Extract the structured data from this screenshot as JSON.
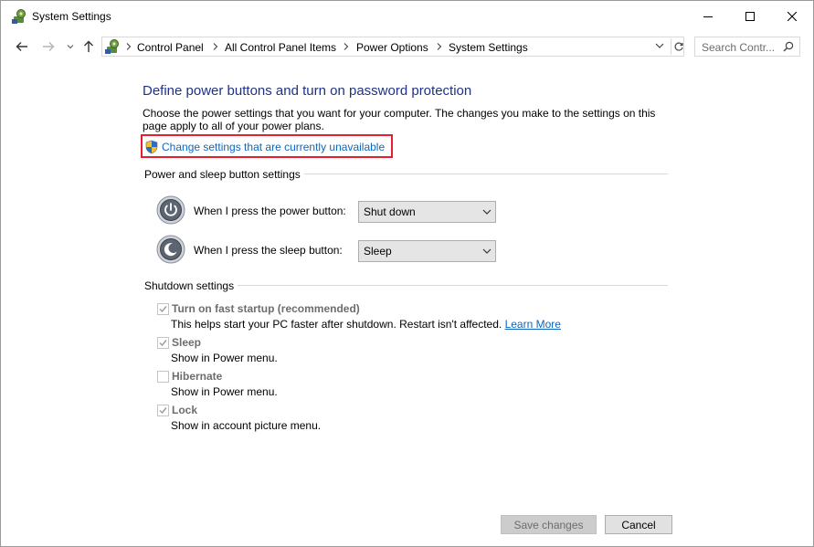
{
  "window": {
    "title": "System Settings"
  },
  "nav": {
    "breadcrumbs": [
      "Control Panel",
      "All Control Panel Items",
      "Power Options",
      "System Settings"
    ],
    "search_placeholder": "Search Contr..."
  },
  "page": {
    "heading": "Define power buttons and turn on password protection",
    "description": "Choose the power settings that you want for your computer. The changes you make to the settings on this page apply to all of your power plans.",
    "change_link": "Change settings that are currently unavailable"
  },
  "power_section": {
    "title": "Power and sleep button settings",
    "rows": [
      {
        "label": "When I press the power button:",
        "value": "Shut down",
        "icon": "power-icon"
      },
      {
        "label": "When I press the sleep button:",
        "value": "Sleep",
        "icon": "sleep-icon"
      }
    ]
  },
  "shutdown_section": {
    "title": "Shutdown settings",
    "options": [
      {
        "label": "Turn on fast startup (recommended)",
        "desc": "This helps start your PC faster after shutdown. Restart isn't affected.",
        "link": "Learn More",
        "checked": true
      },
      {
        "label": "Sleep",
        "desc": "Show in Power menu.",
        "checked": true
      },
      {
        "label": "Hibernate",
        "desc": "Show in Power menu.",
        "checked": false
      },
      {
        "label": "Lock",
        "desc": "Show in account picture menu.",
        "checked": true
      }
    ]
  },
  "footer": {
    "save_label": "Save changes",
    "cancel_label": "Cancel"
  },
  "colors": {
    "heading": "#1e3287",
    "link": "#0b66c2",
    "highlight": "#e5202e"
  }
}
